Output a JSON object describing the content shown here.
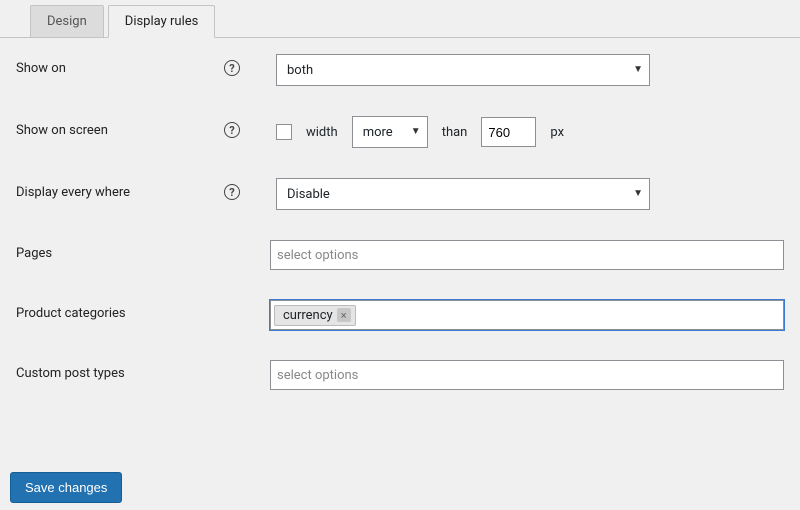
{
  "tabs": {
    "design": "Design",
    "display_rules": "Display rules"
  },
  "fields": {
    "show_on": {
      "label": "Show on",
      "value": "both"
    },
    "show_on_screen": {
      "label": "Show on screen",
      "width_label": "width",
      "comparator": "more",
      "than_label": "than",
      "value": "760",
      "unit": "px"
    },
    "display_everywhere": {
      "label": "Display every where",
      "value": "Disable"
    },
    "pages": {
      "label": "Pages",
      "placeholder": "select options"
    },
    "product_categories": {
      "label": "Product categories",
      "tag": "currency"
    },
    "custom_post_types": {
      "label": "Custom post types",
      "placeholder": "select options"
    }
  },
  "buttons": {
    "save": "Save changes"
  },
  "help": "?"
}
